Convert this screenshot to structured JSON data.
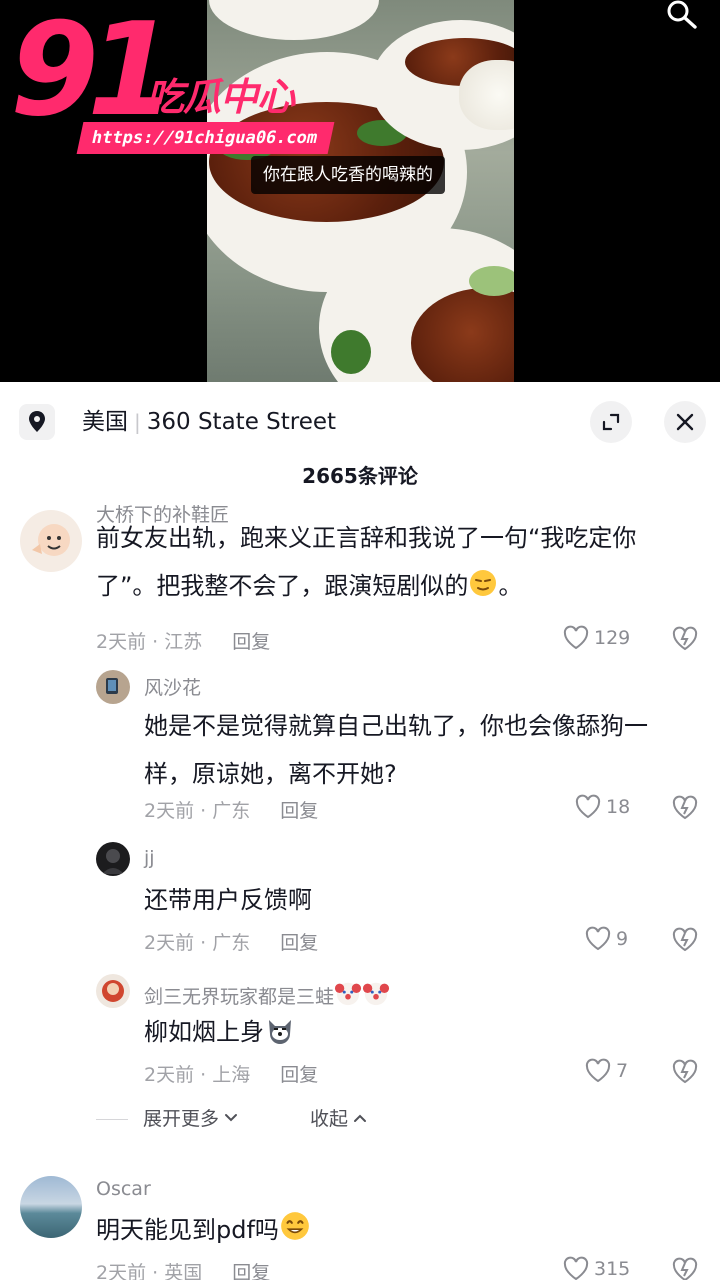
{
  "video": {
    "subtitle": "你在跟人吃香的喝辣的",
    "watermark": {
      "number": "91",
      "text": "吃瓜中心",
      "url": "https://91chigua06.com"
    }
  },
  "sheet": {
    "location_region": "美国",
    "location_place": "360 State Street",
    "comment_count": "2665条评论"
  },
  "comments": [
    {
      "username": "大桥下的补鞋匠",
      "text_line1": "前女友出轨，跑来义正言辞和我说了一句“我吃定你",
      "text_line2": "了”。把我整不会了，跟演短剧似的",
      "text_line2_tail": "。",
      "time": "2天前 · 江苏",
      "reply": "回复",
      "likes": "129"
    },
    {
      "username": "风沙花",
      "text_line1": "她是不是觉得就算自己出轨了，你也会像舔狗一",
      "text_line2": "样，原谅她，离不开她?",
      "time": "2天前 · 广东",
      "reply": "回复",
      "likes": "18"
    },
    {
      "username": "jj",
      "text_line1": "还带用户反馈啊",
      "time": "2天前 · 广东",
      "reply": "回复",
      "likes": "9"
    },
    {
      "username": "剑三无界玩家都是三蛙",
      "text_line1": "柳如烟上身",
      "time": "2天前 · 上海",
      "reply": "回复",
      "likes": "7"
    },
    {
      "username": "Oscar",
      "text_line1": "明天能见到pdf吗",
      "time": "2天前 · 英国",
      "reply": "回复",
      "likes": "315"
    }
  ],
  "thread_controls": {
    "expand_more": "展开更多",
    "collapse": "收起"
  },
  "icons": [
    "search-icon",
    "location-pin-icon",
    "expand-icon",
    "close-icon",
    "heart-icon",
    "dislike-heart-icon",
    "chevron-down-icon",
    "chevron-up-icon"
  ],
  "colors": {
    "brand": "#ff2a6d",
    "text": "#161823",
    "meta": "#a1a2a7"
  }
}
